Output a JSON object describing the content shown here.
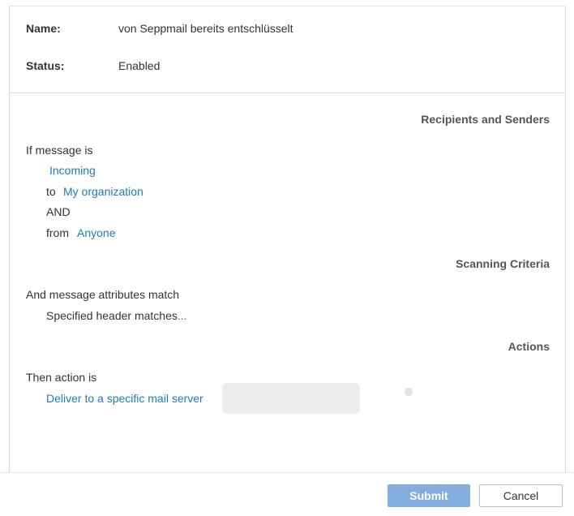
{
  "rule": {
    "name_label": "Name:",
    "name_value": "von Seppmail bereits entschlüsselt",
    "status_label": "Status:",
    "status_value": "Enabled"
  },
  "recipients": {
    "heading": "Recipients and Senders",
    "intro": "If message is",
    "direction": "Incoming",
    "to_label": "to",
    "to_value": "My organization",
    "and_label": "AND",
    "from_label": "from",
    "from_value": "Anyone"
  },
  "scanning": {
    "heading": "Scanning Criteria",
    "intro": "And message attributes match",
    "criteria_text": "Specified header matches",
    "criteria_link": "..."
  },
  "actions": {
    "heading": "Actions",
    "intro": "Then action is",
    "action_link": "Deliver to a specific mail server"
  },
  "footer": {
    "submit_label": "Submit",
    "cancel_label": "Cancel"
  }
}
